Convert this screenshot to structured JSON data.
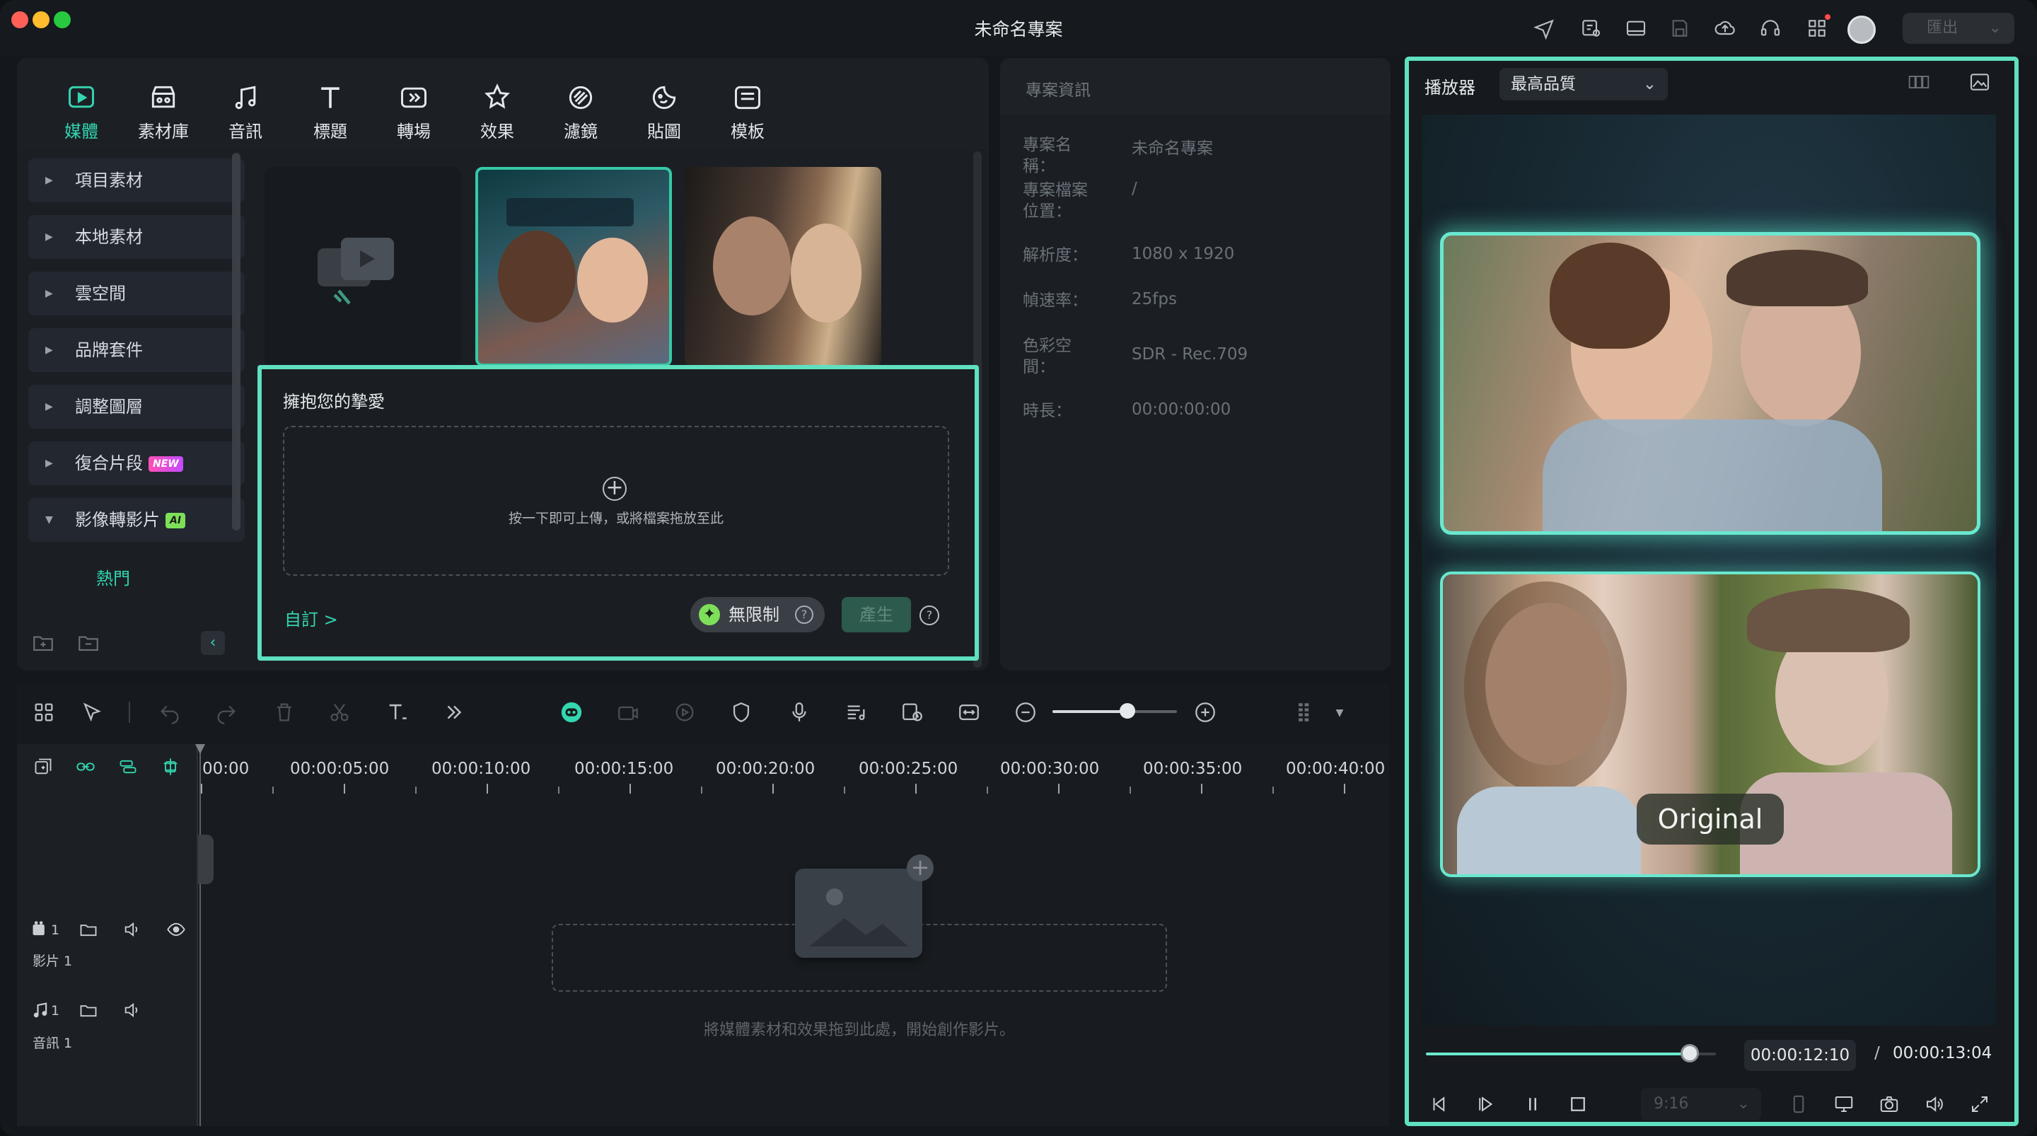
{
  "window": {
    "title": "未命名專案",
    "export_label": "匯出"
  },
  "top_icons": [
    "send-icon",
    "save-template-icon",
    "layout-icon",
    "save-icon",
    "cloud-upload-icon",
    "headset-icon",
    "apps-icon"
  ],
  "tabs": [
    {
      "label": "媒體",
      "icon": "media-icon",
      "active": true
    },
    {
      "label": "素材庫",
      "icon": "store-icon"
    },
    {
      "label": "音訊",
      "icon": "music-icon"
    },
    {
      "label": "標題",
      "icon": "title-icon"
    },
    {
      "label": "轉場",
      "icon": "transition-icon"
    },
    {
      "label": "效果",
      "icon": "effects-icon"
    },
    {
      "label": "濾鏡",
      "icon": "filter-icon"
    },
    {
      "label": "貼圖",
      "icon": "sticker-icon"
    },
    {
      "label": "模板",
      "icon": "template-icon"
    }
  ],
  "sidebar": {
    "items": [
      {
        "label": "項目素材"
      },
      {
        "label": "本地素材"
      },
      {
        "label": "雲空間"
      },
      {
        "label": "品牌套件"
      },
      {
        "label": "調整圖層"
      },
      {
        "label": "復合片段",
        "badge": "NEW"
      },
      {
        "label": "影像轉影片",
        "badge": "AI",
        "expanded": true
      }
    ],
    "sub_item": "熱門"
  },
  "popup": {
    "title": "擁抱您的摯愛",
    "upload_hint": "按一下即可上傳，或將檔案拖放至此",
    "customize": "自訂 >",
    "unlimited": "無限制",
    "generate": "產生"
  },
  "project_info": {
    "title": "專案資訊",
    "rows": [
      {
        "label": "專案名稱：",
        "value": "未命名專案"
      },
      {
        "label": "專案檔案位置：",
        "value": "/"
      },
      {
        "label": "解析度：",
        "value": "1080 x 1920"
      },
      {
        "label": "幀速率：",
        "value": "25fps"
      },
      {
        "label": "色彩空間：",
        "value": "SDR - Rec.709"
      },
      {
        "label": "時長：",
        "value": "00:00:00:00"
      }
    ]
  },
  "player": {
    "label": "播放器",
    "quality": "最高品質",
    "overlay_text": "Original",
    "current_time": "00:00:12:10",
    "separator": "/",
    "total_time": "00:00:13:04",
    "progress": 0.91,
    "aspect_ratio": "9:16"
  },
  "timeline": {
    "ruler": [
      "00:00",
      "00:00:05:00",
      "00:00:10:00",
      "00:00:15:00",
      "00:00:20:00",
      "00:00:25:00",
      "00:00:30:00",
      "00:00:35:00",
      "00:00:40:00"
    ],
    "tracks": [
      {
        "label": "影片 1",
        "number": "1"
      },
      {
        "label": "音訊 1",
        "number": "1"
      }
    ],
    "empty_hint": "將媒體素材和效果拖到此處，開始創作影片。",
    "zoom": 0.6
  },
  "colors": {
    "accent": "#34d6b0",
    "highlight_border": "#5fe0c0"
  }
}
